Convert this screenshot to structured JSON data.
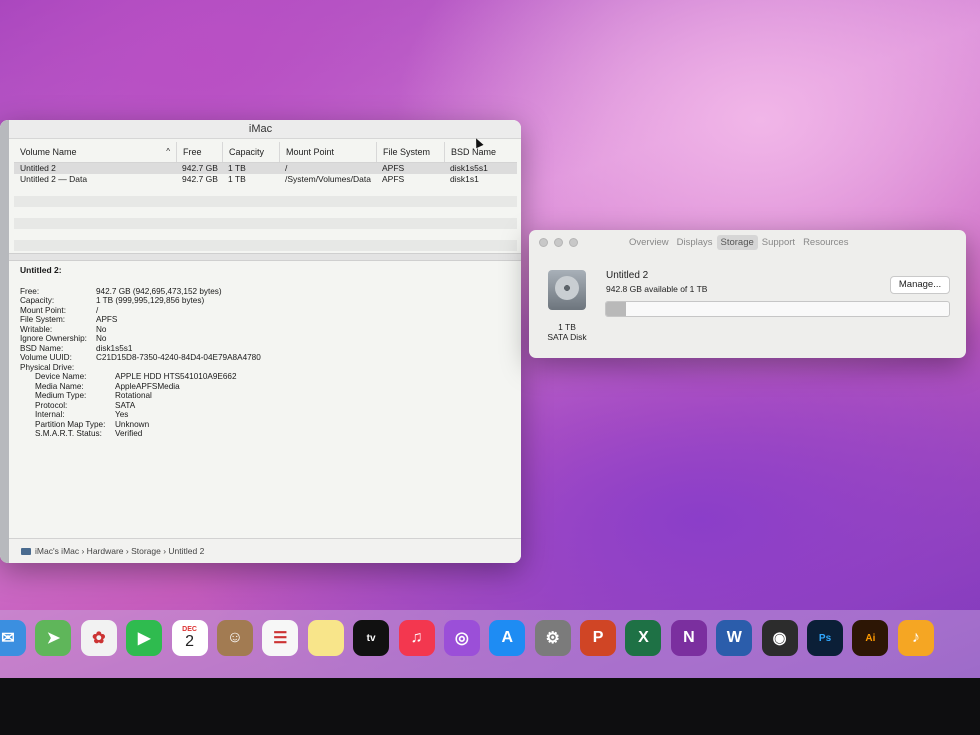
{
  "disk_utility": {
    "window_title": "iMac",
    "columns": [
      "Volume Name",
      "Free",
      "Capacity",
      "Mount Point",
      "File System",
      "BSD Name"
    ],
    "sort_indicator": "^",
    "rows": [
      {
        "name": "Untitled 2",
        "free": "942.7 GB",
        "capacity": "1 TB",
        "mount": "/",
        "fs": "APFS",
        "bsd": "disk1s5s1"
      },
      {
        "name": "Untitled 2 — Data",
        "free": "942.7 GB",
        "capacity": "1 TB",
        "mount": "/System/Volumes/Data",
        "fs": "APFS",
        "bsd": "disk1s1"
      }
    ],
    "detail_title": "Untitled 2:",
    "details": [
      {
        "k": "Free:",
        "v": "942.7 GB (942,695,473,152 bytes)"
      },
      {
        "k": "Capacity:",
        "v": "1 TB (999,995,129,856 bytes)"
      },
      {
        "k": "Mount Point:",
        "v": "/"
      },
      {
        "k": "File System:",
        "v": "APFS"
      },
      {
        "k": "Writable:",
        "v": "No"
      },
      {
        "k": "Ignore Ownership:",
        "v": "No"
      },
      {
        "k": "BSD Name:",
        "v": "disk1s5s1"
      },
      {
        "k": "Volume UUID:",
        "v": "C21D15D8-7350-4240-84D4-04E79A8A4780"
      },
      {
        "k": "Physical Drive:",
        "v": ""
      }
    ],
    "physical": [
      {
        "k": "Device Name:",
        "v": "APPLE HDD HTS541010A9E662"
      },
      {
        "k": "Media Name:",
        "v": "AppleAPFSMedia"
      },
      {
        "k": "Medium Type:",
        "v": "Rotational"
      },
      {
        "k": "Protocol:",
        "v": "SATA"
      },
      {
        "k": "Internal:",
        "v": "Yes"
      },
      {
        "k": "Partition Map Type:",
        "v": "Unknown"
      },
      {
        "k": "S.M.A.R.T. Status:",
        "v": "Verified"
      }
    ],
    "pathbar": "iMac's iMac › Hardware › Storage › Untitled 2"
  },
  "about": {
    "tabs": [
      "Overview",
      "Displays",
      "Storage",
      "Support",
      "Resources"
    ],
    "active_tab": "Storage",
    "volume": "Untitled 2",
    "available": "942.8 GB available of 1 TB",
    "manage_label": "Manage...",
    "disk_size": "1 TB",
    "disk_type": "SATA Disk",
    "used_fraction": 0.057
  },
  "dock": [
    {
      "name": "mail-icon",
      "label": "✉",
      "color": "#3b8fe0"
    },
    {
      "name": "maps-icon",
      "label": "➤",
      "color": "#5fb65a"
    },
    {
      "name": "photos-icon",
      "label": "✿",
      "color": "#f2f2f2"
    },
    {
      "name": "facetime-icon",
      "label": "▶",
      "color": "#2fbb4f"
    },
    {
      "name": "calendar-icon",
      "label": "2",
      "top": "DEC",
      "color": "#ffffff"
    },
    {
      "name": "contacts-icon",
      "label": "☺",
      "color": "#a27b52"
    },
    {
      "name": "reminders-icon",
      "label": "☰",
      "color": "#f7f7f7"
    },
    {
      "name": "notes-icon",
      "label": "",
      "color": "#f8e58a"
    },
    {
      "name": "apple-tv-icon",
      "label": "tv",
      "color": "#111111"
    },
    {
      "name": "music-icon",
      "label": "♫",
      "color": "#f3374f"
    },
    {
      "name": "podcasts-icon",
      "label": "◎",
      "color": "#9b4fd8"
    },
    {
      "name": "app-store-icon",
      "label": "A",
      "color": "#1e8cf3"
    },
    {
      "name": "system-preferences-icon",
      "label": "⚙",
      "color": "#7b7b7b"
    },
    {
      "name": "powerpoint-icon",
      "label": "P",
      "color": "#d04525"
    },
    {
      "name": "excel-icon",
      "label": "X",
      "color": "#1e7145"
    },
    {
      "name": "onenote-icon",
      "label": "N",
      "color": "#7b2f9f"
    },
    {
      "name": "word-icon",
      "label": "W",
      "color": "#2b5dab"
    },
    {
      "name": "dvd-player-icon",
      "label": "◉",
      "color": "#2c2c2c"
    },
    {
      "name": "photoshop-icon",
      "label": "Ps",
      "color": "#0b1f37",
      "fg": "#31a8ff"
    },
    {
      "name": "illustrator-icon",
      "label": "Ai",
      "color": "#2d1605",
      "fg": "#ff9a00"
    },
    {
      "name": "garageband-icon",
      "label": "♪",
      "color": "#f5a623"
    }
  ]
}
